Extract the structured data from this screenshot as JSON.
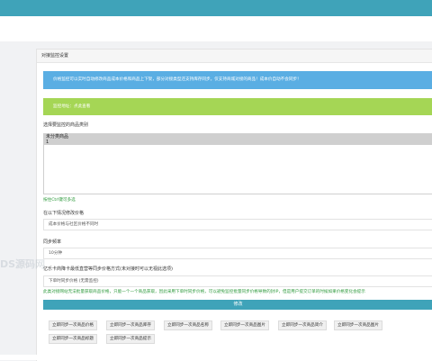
{
  "panel": {
    "title": "对接监控设置"
  },
  "alerts": {
    "info": "价格监控可以实时自动修改商品成本价格和商品上下架，部分对接类型还支持库存同步。仅支持商城对接的商品！成本价自动不会同步！",
    "success": "监控地址：点此查看"
  },
  "category": {
    "label": "选择要监控的商品类别",
    "options": [
      "未分类商品",
      "1"
    ],
    "hint": "按住Ctrl键可多选"
  },
  "price_mode": {
    "label": "在以下情况修改价格",
    "value": "成本价格与社区价格不同时"
  },
  "frequency": {
    "label": "同步频率",
    "value": "10分钟"
  },
  "trade_mode": {
    "label": "亿乐卡商降卡最低直营等同步价格方式(未对接时可以无视此选项)",
    "value": "下单时同步价格 (无需监控)",
    "note": "此类对接网站无法批量获取商品价格，只能一个一个商品获取，因此采用下单时同步价格，可以避免监控批量同步价格导致的封IP，但是用户提交订单的时候如果价格变化会提示"
  },
  "submit_label": "修改",
  "actions": [
    "立即同步一次商品价格",
    "立即同步一次商品库存",
    "立即同步一次商品名称",
    "立即同步一次商品图片",
    "立即同步一次商品简介",
    "立即同步一次商品图片",
    "立即同步一次商品标题",
    "立即同步一次商品提示"
  ],
  "watermark": "DS源码网"
}
